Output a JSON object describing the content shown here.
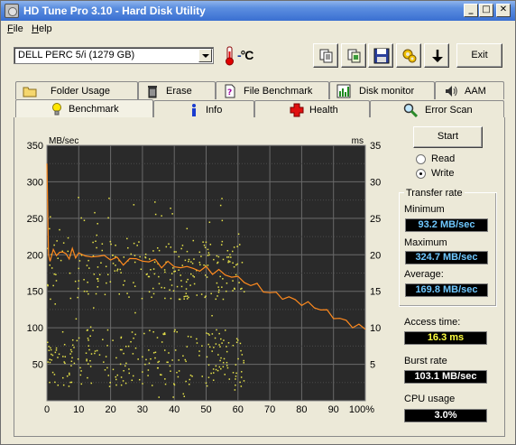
{
  "window": {
    "title": "HD Tune Pro 3.10 - Hard Disk Utility"
  },
  "menu": {
    "file": "File",
    "help": "Help"
  },
  "drive": {
    "selected": "DELL    PERC 5/i (1279 GB)"
  },
  "temperature": {
    "value": "-",
    "unit": "°C"
  },
  "toolbar": {
    "exit": "Exit"
  },
  "tabs_top": [
    {
      "label": "Folder Usage",
      "icon": "folder-icon"
    },
    {
      "label": "Erase",
      "icon": "trash-icon"
    },
    {
      "label": "File Benchmark",
      "icon": "file-benchmark-icon"
    },
    {
      "label": "Disk monitor",
      "icon": "disk-monitor-icon"
    },
    {
      "label": "AAM",
      "icon": "speaker-icon"
    }
  ],
  "tabs_bottom": [
    {
      "label": "Benchmark",
      "icon": "lightbulb-icon",
      "active": true
    },
    {
      "label": "Info",
      "icon": "info-icon"
    },
    {
      "label": "Health",
      "icon": "health-cross-icon"
    },
    {
      "label": "Error Scan",
      "icon": "magnifier-icon"
    }
  ],
  "controls": {
    "start": "Start",
    "read": "Read",
    "write": "Write",
    "selected_mode": "Write"
  },
  "transfer_rate": {
    "title": "Transfer rate",
    "minimum_label": "Minimum",
    "minimum": "93.2 MB/sec",
    "maximum_label": "Maximum",
    "maximum": "324.7 MB/sec",
    "average_label": "Average:",
    "average": "169.8 MB/sec"
  },
  "access_time": {
    "label": "Access time:",
    "value": "16.3 ms"
  },
  "burst_rate": {
    "label": "Burst rate",
    "value": "103.1 MB/sec"
  },
  "cpu_usage": {
    "label": "CPU usage",
    "value": "3.0%"
  },
  "colors": {
    "transfer_line": "#ff8a1e",
    "access_dots": "#e8e44a",
    "chart_bg": "#2a2a2a",
    "chart_grid": "#6a6a6a",
    "lcd_blue": "#6fc8ff",
    "lcd_yellow": "#ffff40",
    "lcd_white": "#ffffff"
  },
  "chart_data": {
    "type": "line",
    "xlabel": "",
    "y_left_unit": "MB/sec",
    "y_right_unit": "ms",
    "x_ticks": [
      "0",
      "10",
      "20",
      "30",
      "40",
      "50",
      "60",
      "70",
      "80",
      "90",
      "100%"
    ],
    "y_left_ticks": [
      "50",
      "100",
      "150",
      "200",
      "250",
      "300",
      "350"
    ],
    "y_right_ticks": [
      "5",
      "10",
      "15",
      "20",
      "25",
      "30",
      "35"
    ],
    "xlim": [
      0,
      100
    ],
    "ylim_left": [
      0,
      350
    ],
    "ylim_right": [
      0,
      35
    ],
    "grid": true,
    "series": [
      {
        "x": [
          0,
          0.5,
          1,
          2,
          3,
          4,
          5,
          6,
          7,
          8,
          9,
          10,
          12,
          14,
          16,
          18,
          20,
          22,
          24,
          26,
          28,
          30,
          32,
          34,
          36,
          38,
          40,
          42,
          44,
          46,
          48,
          50,
          52,
          54,
          56,
          58,
          60,
          62,
          64,
          66,
          68,
          70,
          72,
          74,
          76,
          78,
          80,
          82,
          84,
          86,
          88,
          90,
          92,
          94,
          96,
          98,
          100
        ],
        "y": [
          325,
          200,
          195,
          205,
          198,
          207,
          200,
          203,
          196,
          205,
          199,
          202,
          196,
          201,
          195,
          199,
          196,
          193,
          188,
          196,
          191,
          195,
          189,
          192,
          186,
          188,
          184,
          185,
          180,
          184,
          178,
          181,
          177,
          178,
          171,
          173,
          167,
          163,
          160,
          157,
          152,
          148,
          146,
          143,
          140,
          138,
          134,
          132,
          129,
          126,
          121,
          116,
          112,
          108,
          104,
          102,
          98
        ]
      }
    ],
    "access_time_scatter": {
      "y_min_ms": 0,
      "y_max_ms": 28,
      "x_range": [
        0,
        62
      ],
      "density": "high between 2-10 ms and 14-22 ms"
    }
  }
}
